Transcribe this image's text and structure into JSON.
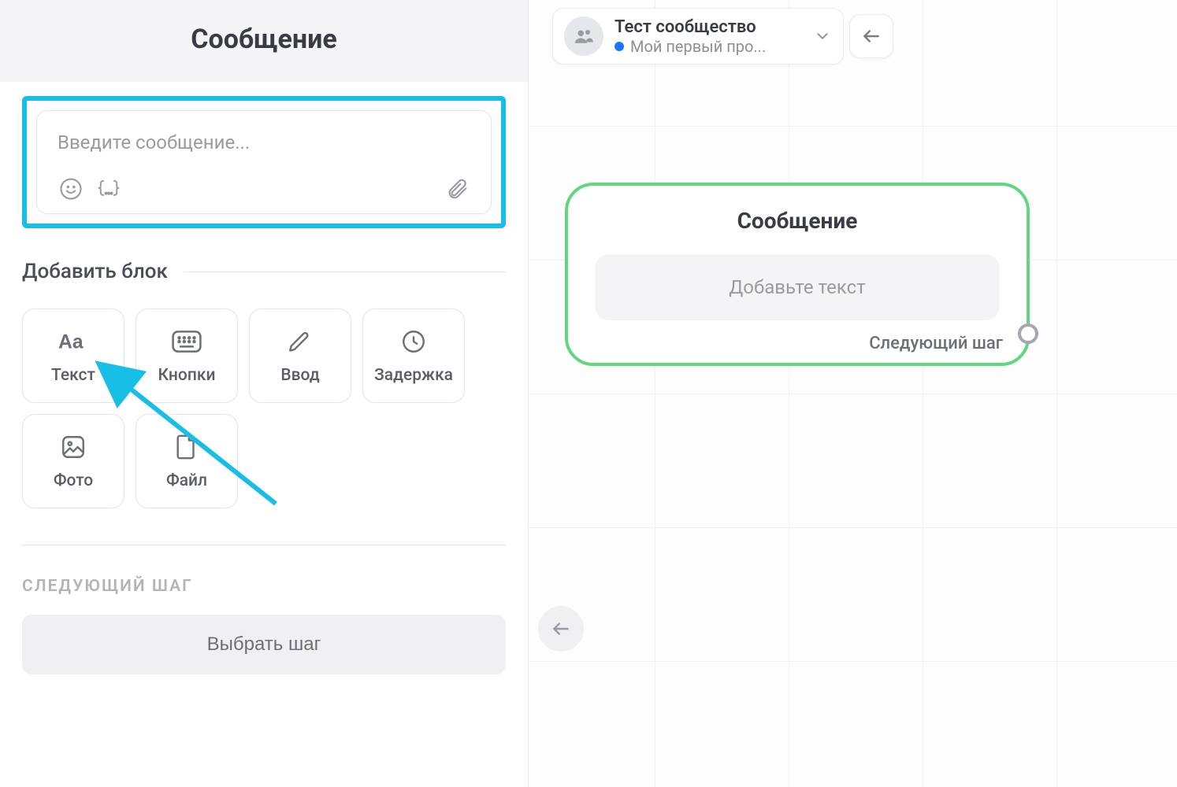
{
  "left": {
    "title": "Сообщение",
    "message_input": {
      "placeholder": "Введите сообщение..."
    },
    "add_block_title": "Добавить блок",
    "blocks": {
      "text": {
        "label": "Текст"
      },
      "buttons": {
        "label": "Кнопки"
      },
      "input": {
        "label": "Ввод"
      },
      "delay": {
        "label": "Задержка"
      },
      "photo": {
        "label": "Фото"
      },
      "file": {
        "label": "Файл"
      }
    },
    "next_step_heading": "СЛЕДУЮЩИЙ ШАГ",
    "choose_step_button": "Выбрать шаг"
  },
  "canvas": {
    "community": {
      "title": "Тест сообщество",
      "subtitle": "Мой первый про...",
      "status_color": "#1f74ff"
    },
    "node": {
      "title": "Сообщение",
      "placeholder": "Добавьте текст",
      "next_step_label": "Следующий шаг"
    }
  }
}
